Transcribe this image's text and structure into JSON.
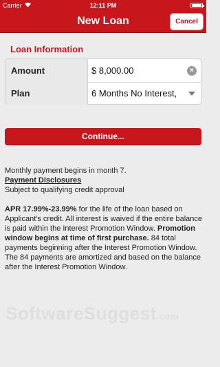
{
  "status_bar": {
    "carrier": "Carrier",
    "time": "12:11 PM",
    "battery_level": 1.0
  },
  "nav": {
    "title": "New Loan",
    "cancel_label": "Cancel"
  },
  "form": {
    "section_title": "Loan Information",
    "amount_label": "Amount",
    "amount_value": "$ 8,000.00",
    "plan_label": "Plan",
    "plan_value": "6 Months No Interest,"
  },
  "continue_label": "Continue...",
  "info": {
    "line1": "Monthly payment begins in month 7.",
    "disclosures_link": "Payment Disclosures",
    "line3": "Subject to qualifying credit approval",
    "apr_bold": "APR 17.99%-23.99%",
    "apr_text": " for the life of the loan based on Applicant's credit. All interest is waived if the entire balance is paid within the Interest Promotion Window.",
    "promo_bold": "Promotion window begins at time of first purchase.",
    "promo_text": " 84 total payments beginning after the Interest Promotion Window. The 84 payments are amortized and based on the balance after the Interest Promotion Window."
  },
  "watermark": {
    "main": "SoftwareSuggest",
    "suffix": ".com"
  },
  "colors": {
    "brand_red": "#c8161d",
    "background": "#ececec"
  }
}
